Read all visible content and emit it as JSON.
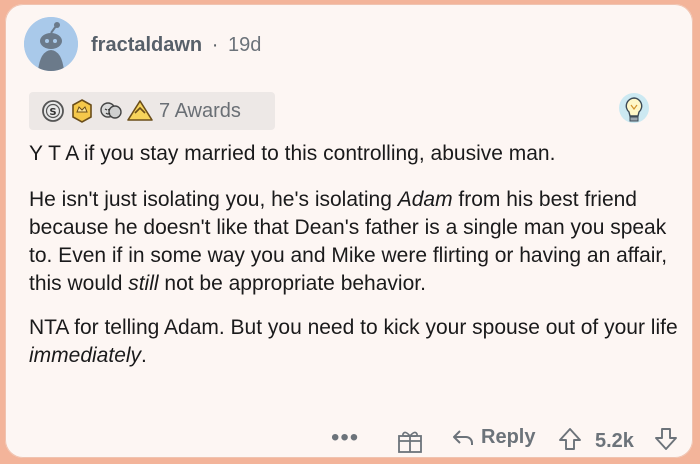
{
  "comment": {
    "username": "fractaldawn",
    "separator": "·",
    "age": "19d",
    "awards_label": "7 Awards",
    "paragraphs": {
      "p1": "Y T A if you stay married to this controlling, abusive man.",
      "p2_a": "He isn't just isolating you, he's isolating ",
      "p2_em1": "Adam",
      "p2_b": " from his best friend because he doesn't like that Dean's father is a single man you speak to. Even if in some way you and Mike were flirting or having an affair, this would ",
      "p2_em2": "still",
      "p2_c": " not be appropriate behavior.",
      "p3_a": "NTA for telling Adam. But you need to kick your spouse out of your life ",
      "p3_em": "immediately",
      "p3_b": "."
    }
  },
  "footer": {
    "more_label": "•••",
    "reply_label": "Reply",
    "score": "5.2k"
  },
  "icons": {
    "avatar": "reddit-avatar-icon",
    "award1": "silver-award-icon",
    "award2": "gold-award-icon",
    "award3": "wholesome-award-icon",
    "award4": "helpful-award-icon",
    "bulb": "lightbulb-icon",
    "gift": "gift-icon",
    "reply": "reply-arrow-icon",
    "upvote": "upvote-icon",
    "downvote": "downvote-icon"
  },
  "colors": {
    "background": "#f3b49a",
    "card": "#fdf6f3",
    "avatar_bg": "#a9c9ea",
    "muted_text": "#6c737a"
  }
}
